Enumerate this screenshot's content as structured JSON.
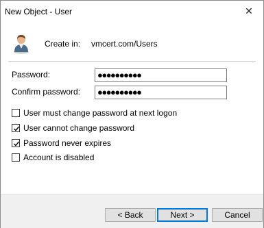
{
  "window": {
    "title": "New Object - User",
    "close_glyph": "✕"
  },
  "header": {
    "create_in_label": "Create in:",
    "create_in_value": "vmcert.com/Users",
    "icon": "user-icon"
  },
  "form": {
    "password_label": "Password:",
    "password_value": "●●●●●●●●●●",
    "confirm_label": "Confirm password:",
    "confirm_value": "●●●●●●●●●●"
  },
  "options": [
    {
      "label": "User must change password at next logon",
      "checked": false
    },
    {
      "label": "User cannot change password",
      "checked": true
    },
    {
      "label": "Password never expires",
      "checked": true
    },
    {
      "label": "Account is disabled",
      "checked": false
    }
  ],
  "buttons": {
    "back": "< Back",
    "next": "Next >",
    "cancel": "Cancel"
  },
  "colors": {
    "accent": "#0078d7",
    "footer_bg": "#f0f0f0"
  }
}
